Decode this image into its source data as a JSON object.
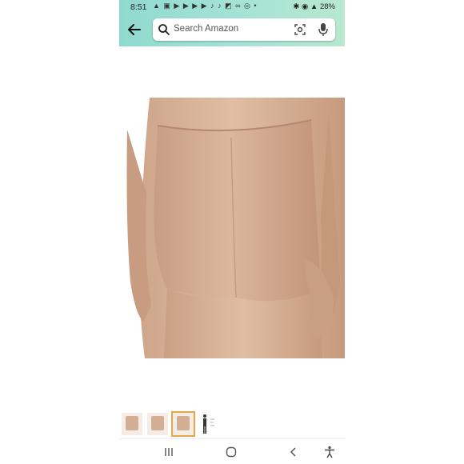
{
  "status_bar": {
    "time": "8:51",
    "notification_icons": "▲ ▣ ▶ ▶ ▶ ▶ ♪ ♪ ◩ ∞ ◎ •",
    "right_indicators": "✱ ◉ ▲ 28%",
    "battery_percent": "28%"
  },
  "search_bar": {
    "placeholder": "Search Amazon",
    "icons": [
      "back-arrow-icon",
      "search-icon",
      "camera-scan-icon",
      "microphone-icon"
    ]
  },
  "product_gallery": {
    "main_image": "product-photo-nude-shorts-back-view",
    "thumbnails": [
      {
        "name": "thumbnail-front",
        "selected": false
      },
      {
        "name": "thumbnail-side",
        "selected": false
      },
      {
        "name": "thumbnail-back",
        "selected": true
      },
      {
        "name": "thumbnail-size-chart",
        "selected": false
      }
    ],
    "accent_color": "#e3a64a"
  },
  "nav_bar": {
    "icons": [
      "recents-icon",
      "home-icon",
      "back-icon",
      "accessibility-icon"
    ]
  }
}
